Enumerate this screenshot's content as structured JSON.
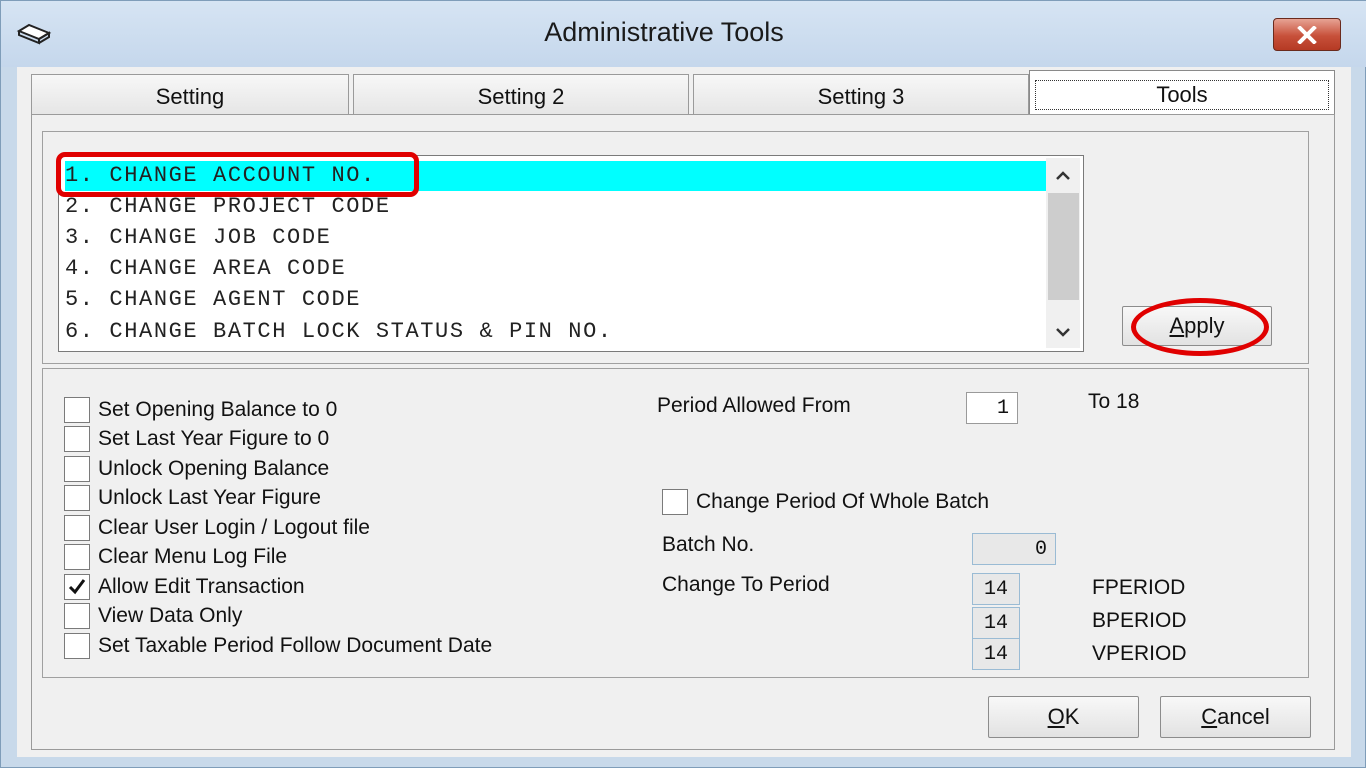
{
  "window": {
    "title": "Administrative Tools"
  },
  "tabs": [
    {
      "label": "Setting"
    },
    {
      "label": "Setting 2"
    },
    {
      "label": "Setting 3"
    },
    {
      "label": "Tools"
    }
  ],
  "tools_list": {
    "items": [
      "1. CHANGE ACCOUNT NO.",
      "2. CHANGE PROJECT CODE",
      "3. CHANGE JOB CODE",
      "4. CHANGE AREA CODE",
      "5. CHANGE AGENT CODE",
      "6. CHANGE BATCH LOCK STATUS & PIN NO."
    ],
    "selected_index": 0
  },
  "apply_button": {
    "label_underlined": "A",
    "label_rest": "pply"
  },
  "options": [
    {
      "label": "Set Opening Balance to 0",
      "checked": false
    },
    {
      "label": "Set Last Year Figure to 0",
      "checked": false
    },
    {
      "label": "Unlock Opening Balance",
      "checked": false
    },
    {
      "label": "Unlock Last Year Figure",
      "checked": false
    },
    {
      "label": "Clear User Login / Logout file",
      "checked": false
    },
    {
      "label": "Clear Menu Log File",
      "checked": false
    },
    {
      "label": "Allow Edit Transaction",
      "checked": true
    },
    {
      "label": "View Data Only",
      "checked": false
    },
    {
      "label": "Set Taxable Period Follow Document Date",
      "checked": false
    }
  ],
  "period": {
    "allowed_from_label": "Period Allowed From",
    "allowed_from_value": "1",
    "to_label": "To 18",
    "change_whole_batch_label": "Change Period Of Whole Batch",
    "change_whole_batch_checked": false,
    "batch_no_label": "Batch No.",
    "batch_no_value": "0",
    "change_to_label": "Change To Period",
    "fperiod_value": "14",
    "fperiod_label": "FPERIOD",
    "bperiod_value": "14",
    "bperiod_label": "BPERIOD",
    "vperiod_value": "14",
    "vperiod_label": "VPERIOD"
  },
  "buttons": {
    "ok_underlined": "O",
    "ok_rest": "K",
    "cancel_underlined": "C",
    "cancel_rest": "ancel"
  },
  "colors": {
    "selection": "#00ffff",
    "annotation": "#e00000"
  }
}
